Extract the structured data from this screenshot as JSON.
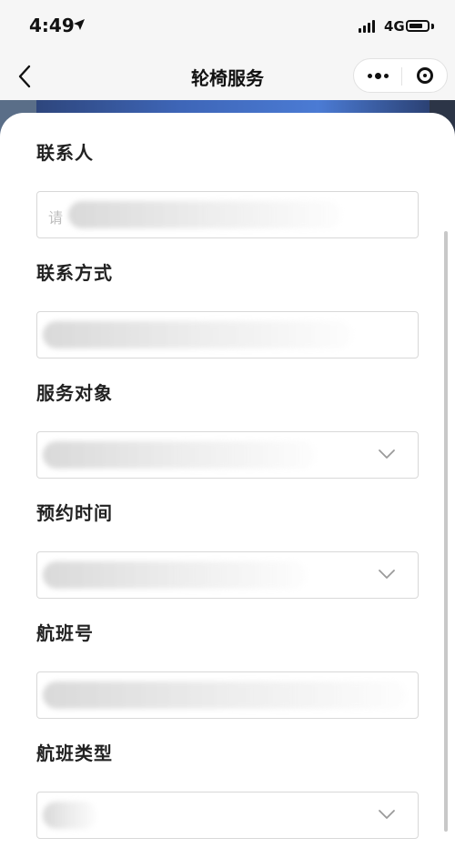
{
  "status_bar": {
    "time": "4:49",
    "network": "4G"
  },
  "nav": {
    "title": "轮椅服务"
  },
  "form": {
    "fields": [
      {
        "label": "联系人",
        "placeholder": "请",
        "type": "text"
      },
      {
        "label": "联系方式",
        "type": "text"
      },
      {
        "label": "服务对象",
        "type": "select"
      },
      {
        "label": "预约时间",
        "type": "select"
      },
      {
        "label": "航班号",
        "type": "text"
      },
      {
        "label": "航班类型",
        "type": "select"
      }
    ]
  },
  "icons": {
    "location": "location-arrow-icon",
    "back": "chevron-left-icon",
    "more": "more-dots-icon",
    "close": "target-close-icon",
    "dropdown": "chevron-down-icon"
  }
}
